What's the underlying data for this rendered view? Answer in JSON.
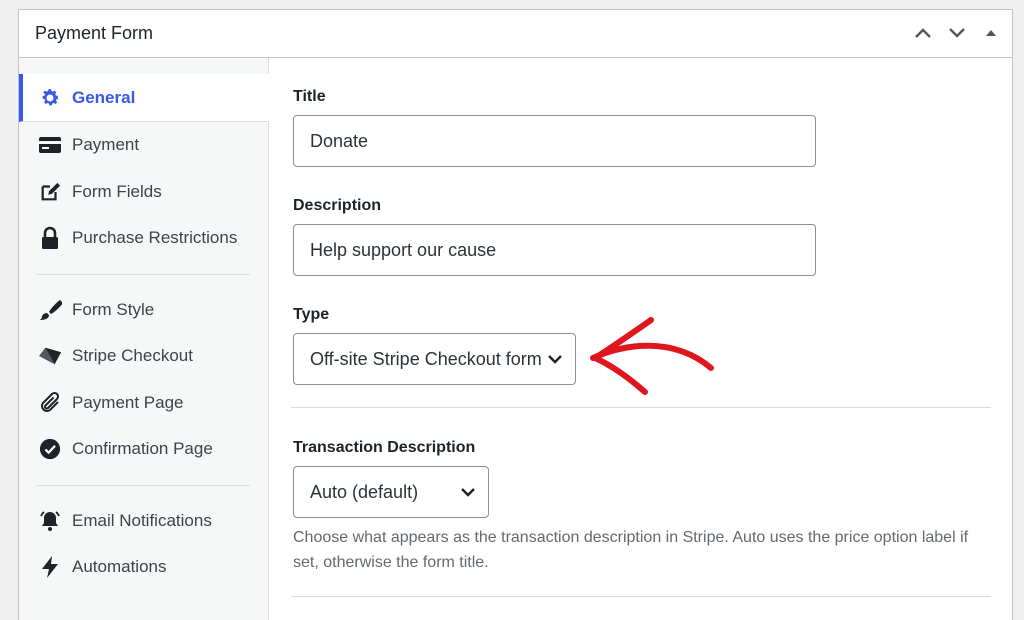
{
  "panel": {
    "title": "Payment Form"
  },
  "sidebar": {
    "items": [
      {
        "label": "General",
        "icon": "gear-icon",
        "active": true
      },
      {
        "label": "Payment",
        "icon": "credit-card-icon"
      },
      {
        "label": "Form Fields",
        "icon": "edit-icon"
      },
      {
        "label": "Purchase Restrictions",
        "icon": "lock-icon"
      },
      {
        "label": "Form Style",
        "icon": "paintbrush-icon"
      },
      {
        "label": "Stripe Checkout",
        "icon": "stripe-icon"
      },
      {
        "label": "Payment Page",
        "icon": "paperclip-icon"
      },
      {
        "label": "Confirmation Page",
        "icon": "check-circle-icon"
      },
      {
        "label": "Email Notifications",
        "icon": "bell-icon"
      },
      {
        "label": "Automations",
        "icon": "bolt-icon"
      }
    ]
  },
  "fields": {
    "title": {
      "label": "Title",
      "value": "Donate"
    },
    "description": {
      "label": "Description",
      "value": "Help support our cause"
    },
    "type": {
      "label": "Type",
      "value": "Off-site Stripe Checkout form"
    },
    "transaction_description": {
      "label": "Transaction Description",
      "value": "Auto (default)",
      "help": "Choose what appears as the transaction description in Stripe. Auto uses the price option label if set, otherwise the form title."
    }
  },
  "colors": {
    "accent": "#3858e9",
    "annotation_arrow": "#e0161e"
  }
}
